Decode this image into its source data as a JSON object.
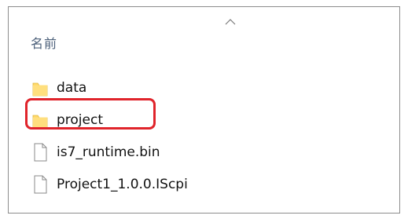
{
  "explorer": {
    "column_header": "名前",
    "sort_indicator_icon": "chevron-up-icon",
    "items": [
      {
        "name": "data",
        "type": "folder",
        "icon": "folder-icon"
      },
      {
        "name": "project",
        "type": "folder",
        "icon": "folder-icon",
        "highlighted": true
      },
      {
        "name": "is7_runtime.bin",
        "type": "file",
        "icon": "file-icon"
      },
      {
        "name": "Project1_1.0.0.IScpi",
        "type": "file",
        "icon": "file-icon"
      }
    ]
  },
  "colors": {
    "highlight_border": "#e0242b",
    "folder_fill": "#ffd867",
    "header_text": "#4c607a"
  }
}
